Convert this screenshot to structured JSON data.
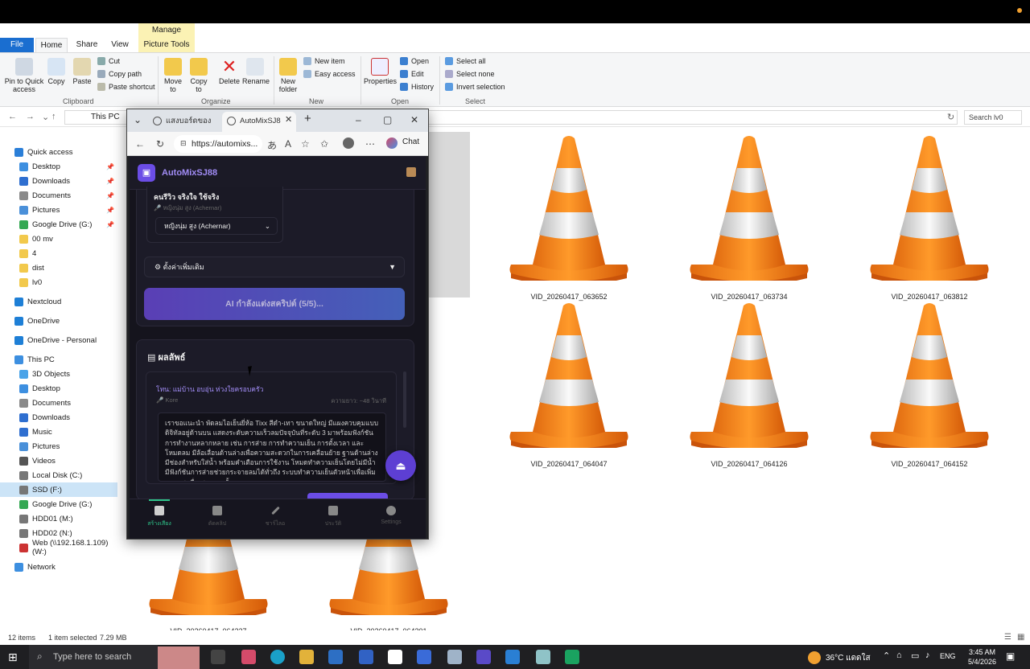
{
  "explorer": {
    "title": "lv0",
    "manage_tab": "Manage",
    "tabs": [
      "File",
      "Home",
      "Share",
      "View",
      "Picture Tools"
    ],
    "ribbon": {
      "pin": "Pin to Quick access",
      "copy": "Copy",
      "paste": "Paste",
      "cut": "Cut",
      "copy_path": "Copy path",
      "paste_shortcut": "Paste shortcut",
      "move_to": "Move to",
      "copy_to": "Copy to",
      "delete": "Delete",
      "rename": "Rename",
      "new_folder": "New folder",
      "new_item": "New item",
      "easy_access": "Easy access",
      "properties": "Properties",
      "open": "Open",
      "edit": "Edit",
      "history": "History",
      "select_all": "Select all",
      "select_none": "Select none",
      "invert_selection": "Invert selection",
      "groups": [
        "Clipboard",
        "Organize",
        "New",
        "Open",
        "Select"
      ]
    },
    "address": "This PC",
    "search_placeholder": "Search lv0",
    "nav": [
      {
        "label": "Quick access",
        "color": "#2b7fd8"
      },
      {
        "label": "Desktop",
        "color": "#3d8fe0",
        "pin": true
      },
      {
        "label": "Downloads",
        "color": "#2f6fd0",
        "pin": true
      },
      {
        "label": "Documents",
        "color": "#8a8a8a",
        "pin": true
      },
      {
        "label": "Pictures",
        "color": "#4a90d9",
        "pin": true
      },
      {
        "label": "Google Drive (G:)",
        "color": "#34a853",
        "pin": true
      },
      {
        "label": "00 mv",
        "color": "#f2c94c"
      },
      {
        "label": "4",
        "color": "#f2c94c"
      },
      {
        "label": "dist",
        "color": "#f2c94c"
      },
      {
        "label": "lv0",
        "color": "#f2c94c"
      },
      {
        "label": "Nextcloud",
        "color": "#1e7fd6"
      },
      {
        "label": "OneDrive",
        "color": "#1e7fd6"
      },
      {
        "label": "OneDrive - Personal",
        "color": "#1e7fd6"
      },
      {
        "label": "This PC",
        "color": "#3d8fe0"
      },
      {
        "label": "3D Objects",
        "color": "#4aa3e8"
      },
      {
        "label": "Desktop",
        "color": "#3d8fe0"
      },
      {
        "label": "Documents",
        "color": "#8a8a8a"
      },
      {
        "label": "Downloads",
        "color": "#2f6fd0"
      },
      {
        "label": "Music",
        "color": "#2f6fd0"
      },
      {
        "label": "Pictures",
        "color": "#4a90d9"
      },
      {
        "label": "Videos",
        "color": "#555"
      },
      {
        "label": "Local Disk (C:)",
        "color": "#777"
      },
      {
        "label": "SSD (F:)",
        "color": "#777"
      },
      {
        "label": "Google Drive (G:)",
        "color": "#34a853"
      },
      {
        "label": "HDD01 (M:)",
        "color": "#777"
      },
      {
        "label": "HDD02 (N:)",
        "color": "#777"
      },
      {
        "label": "Web (\\\\192.168.1.109) (W:)",
        "color": "#c33"
      },
      {
        "label": "Network",
        "color": "#3d8fe0"
      }
    ],
    "files": [
      "VID_20260417_063652",
      "VID_20260417_063734",
      "VID_20260417_063812",
      "VID_20260417_064047",
      "VID_20260417_064126",
      "VID_20260417_064152",
      "VID_20260417_064227",
      "VID_20260417_064301"
    ],
    "status": {
      "count": "12 items",
      "selected": "1 item selected",
      "size": "7.29 MB"
    }
  },
  "browser": {
    "tab1": "แสงบอร์ดของ",
    "tab2": "AutoMixSJ8",
    "url": "https://automixs...",
    "chat": "Chat"
  },
  "app": {
    "title": "AutoMixSJ88",
    "review_text": "คนรีวิว จริงใจ ใช้จริง",
    "voice_hint": "หญิงนุ่ม สูง (Achernar)",
    "voice_select": "หญิงนุ่ม สูง (Achernar)",
    "advanced": "ตั้งค่าเพิ่มเติม",
    "generate_btn": "AI กำลังแต่งสคริปต์ (5/5)...",
    "result_title": "ผลลัพธ์",
    "topic": "โทน: แม่บ้าน อบอุ่น ห่วงใยครอบครัว",
    "voice_small": "Kore",
    "duration": "ความยาว: ~48 วินาที",
    "script": "เราขอแนะนำ พัดลมไอเย็นยี่ห้อ Tixx สีดำ-เทา ขนาดใหญ่ มีแผงควบคุมแบบดิจิทัลอยู่ด้านบน แสดงระดับความเร็วลมปัจจุบันที่ระดับ 3 มาพร้อมฟังก์ชันการทำงานหลากหลาย เช่น การส่าย การทำความเย็น การตั้งเวลา และโหมดลม มีล้อเลื่อนด้านล่างเพื่อความสะดวกในการเคลื่อนย้าย ฐานด้านล่างมีช่องสำหรับใส่น้ำ พร้อมคำเตือนการใช้งาน โหมดทำความเย็นโดยไม่มีน้ำ มีฟังก์ชันการส่ายช่วยกระจายลมได้ทั่วถึง ระบบทำความเย็นตัวหน้าเพื่อเพิ่มความสดชื่น สามารถตั้งเวลาการ",
    "nav": [
      "สร้างเสียง",
      "ตัดคลิป",
      "ชาร์ไลอ",
      "ประวัติ",
      "Settings"
    ]
  },
  "taskbar": {
    "search_placeholder": "Type here to search",
    "weather": "36°C แดดใส",
    "lang": "ENG",
    "time": "3:45 AM",
    "date": "5/4/2026"
  }
}
